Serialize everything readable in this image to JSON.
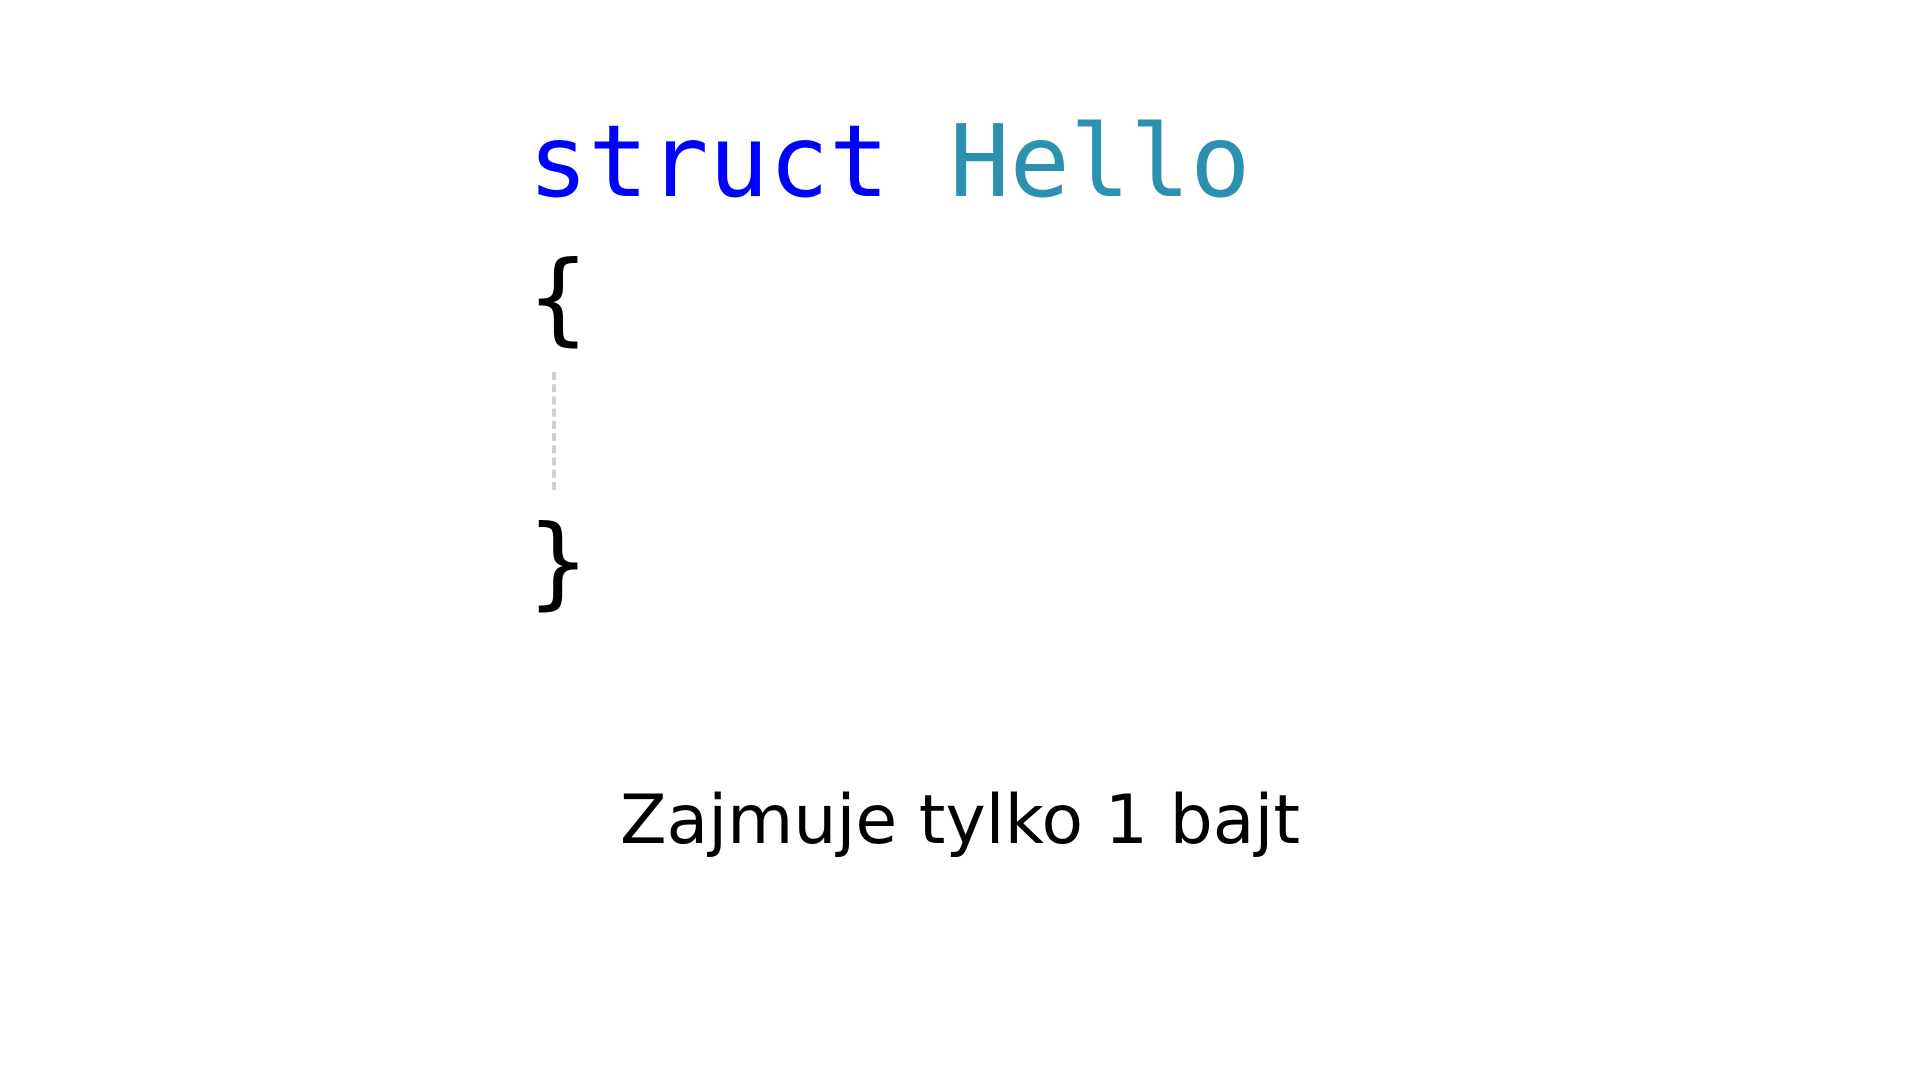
{
  "code": {
    "keyword": "struct",
    "space": " ",
    "type_name": "Hello",
    "open_brace": "{",
    "close_brace": "}"
  },
  "caption": "Zajmuje tylko 1 bajt",
  "colors": {
    "keyword": "#0000ff",
    "type_name": "#2b91af",
    "text": "#000000",
    "indent_guide": "#cfcfcf",
    "background": "#ffffff"
  }
}
